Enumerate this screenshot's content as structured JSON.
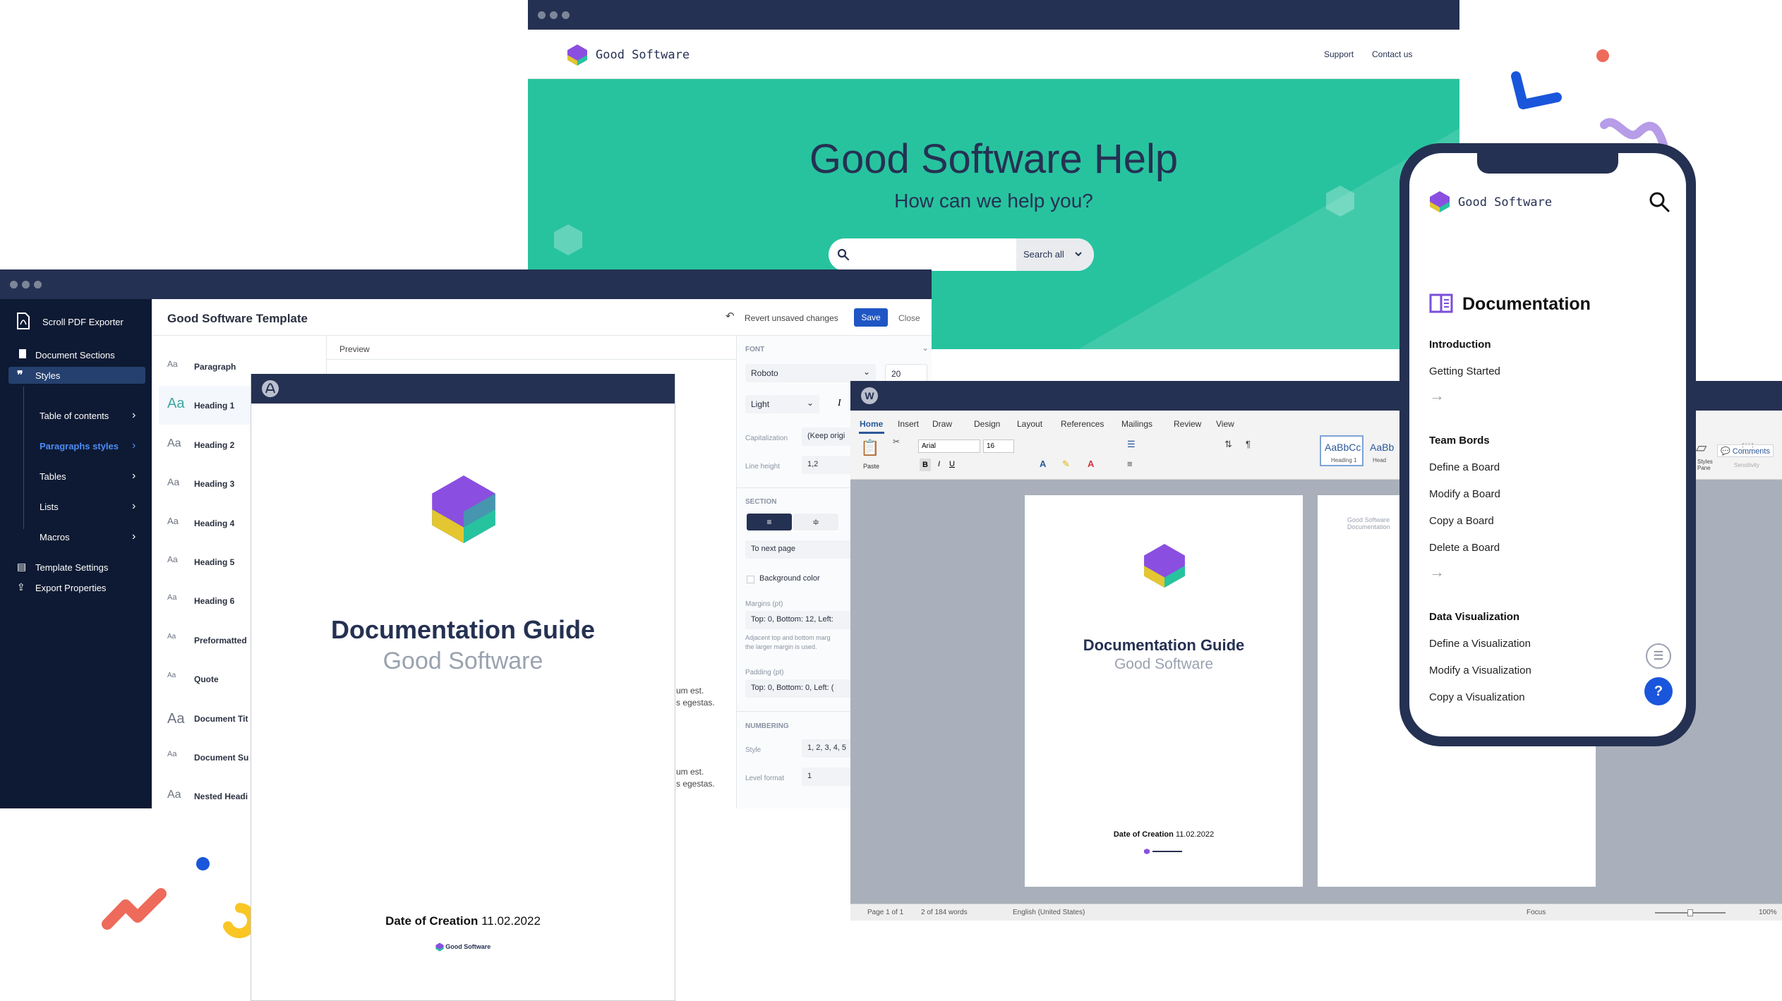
{
  "brand": {
    "name": "Good Software",
    "colors": {
      "teal": "#27c39f",
      "navy": "#253152",
      "purple": "#8a4fe0",
      "blue": "#1a56db",
      "accent_red": "#ee6a5a",
      "accent_yellow": "#f9c623",
      "accent_lilac": "#b79ce8"
    }
  },
  "help_site": {
    "logo_text": "Good Software",
    "nav": [
      "Support",
      "Contact us"
    ],
    "hero_title": "Good Software Help",
    "hero_subtitle": "How can we help you?",
    "search": {
      "placeholder": "",
      "scope_label": "Search all"
    }
  },
  "editor": {
    "app_name": "Scroll PDF Exporter",
    "sidebar": {
      "items": [
        "Document Sections",
        "Styles",
        "Table of contents",
        "Paragraphs styles",
        "Tables",
        "Lists",
        "Macros",
        "Template Settings",
        "Export Properties"
      ]
    },
    "template_title": "Good Software Template",
    "revert_label": "Revert unsaved changes",
    "save_label": "Save",
    "close_label": "Close",
    "styles": [
      {
        "aa": "Aa",
        "name": "Paragraph"
      },
      {
        "aa": "Aa",
        "name": "Heading 1"
      },
      {
        "aa": "Aa",
        "name": "Heading 2"
      },
      {
        "aa": "Aa",
        "name": "Heading 3"
      },
      {
        "aa": "Aa",
        "name": "Heading 4"
      },
      {
        "aa": "Aa",
        "name": "Heading 5"
      },
      {
        "aa": "Aa",
        "name": "Heading 6"
      },
      {
        "aa": "Aa",
        "name": "Preformatted"
      },
      {
        "aa": "Aa",
        "name": "Quote"
      },
      {
        "aa": "Aa",
        "name": "Document Tit"
      },
      {
        "aa": "Aa",
        "name": "Document Su"
      },
      {
        "aa": "Aa",
        "name": "Nested Headi"
      }
    ],
    "preview_label": "Preview",
    "preview_snippets": [
      "um est.",
      "s egestas."
    ],
    "font": {
      "section": "FONT",
      "family": "Roboto",
      "size": "20",
      "weight": "Light",
      "capitalization_label": "Capitalization",
      "capitalization_value": "(Keep origi",
      "line_height_label": "Line height",
      "line_height_value": "1,2"
    },
    "section": {
      "section": "SECTION",
      "break_value": "To next page",
      "background_label": "Background color",
      "margins_label": "Margins (pt)",
      "margins_value": "Top: 0, Bottom: 12, Left:",
      "margins_hint": "Adjacent top and bottom marg",
      "margins_hint2": "the larger margin is used.",
      "padding_label": "Padding (pt)",
      "padding_value": "Top: 0, Bottom: 0, Left: (",
      "numbering_section": "NUMBERING",
      "style_label": "Style",
      "style_value": "1, 2, 3, 4, 5",
      "level_label": "Level format",
      "level_value": "1"
    }
  },
  "pdf_doc": {
    "title": "Documentation Guide",
    "subtitle": "Good Software",
    "date_label": "Date of Creation",
    "date_value": "11.02.2022",
    "footer_logo": "Good Software"
  },
  "word": {
    "tabs": [
      "Home",
      "Insert",
      "Draw",
      "Design",
      "Layout",
      "References",
      "Mailings",
      "Review",
      "View"
    ],
    "comments_label": "Comments",
    "font_name": "Arial",
    "font_size": "16",
    "paste_label": "Paste",
    "style_gallery": [
      {
        "sample": "AaBbCc",
        "name": "Heading 1"
      },
      {
        "sample": "AaBb",
        "name": "Head"
      }
    ],
    "styles_pane_label": "Styles Pane",
    "sensitivity_label": "Sensitivity",
    "doc_title": "Documentation Guide",
    "doc_subtitle": "Good Software",
    "date_label": "Date of Creation",
    "date_value": "11.02.2022",
    "page2_text": "Good Software Documentation",
    "status": {
      "page": "Page 1 of 1",
      "words": "2 of 184 words",
      "language": "English (United States)",
      "focus": "Focus",
      "zoom": "100%"
    }
  },
  "phone": {
    "logo_text": "Good Software",
    "page_title": "Documentation",
    "sections": [
      {
        "heading": "Introduction",
        "links": [
          "Getting Started"
        ]
      },
      {
        "heading": "Team Bords",
        "links": [
          "Define a Board",
          "Modify a Board",
          "Copy a Board",
          "Delete a Board"
        ]
      },
      {
        "heading": "Data Visualization",
        "links": [
          "Define a Visualization",
          "Modify a Visualization",
          "Copy a Visualization"
        ]
      }
    ],
    "help_button": "?"
  }
}
